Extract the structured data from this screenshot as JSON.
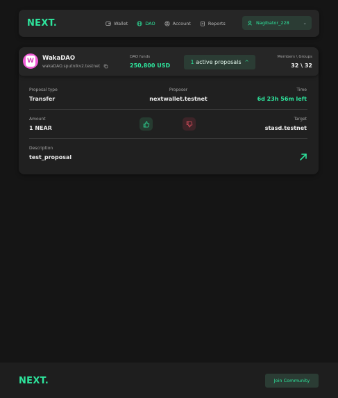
{
  "brand": {
    "logo": "NEXT."
  },
  "nav": {
    "items": [
      {
        "label": "Wallet",
        "icon": "wallet-icon",
        "active": false
      },
      {
        "label": "DAO",
        "icon": "globe-icon",
        "active": true
      },
      {
        "label": "Account",
        "icon": "account-icon",
        "active": false
      },
      {
        "label": "Reports",
        "icon": "reports-icon",
        "active": false
      }
    ],
    "user": {
      "label": "Nagibator_228",
      "icon": "user-icon"
    }
  },
  "dao": {
    "name": "WakaDAO",
    "address": "wakaDAO.sputnikv2.testnet",
    "funds_label": "DAO funds",
    "funds_value": "250,800 USD",
    "proposals_count": "1",
    "proposals_label": "active proposals",
    "members_label": "Members \\ Groups",
    "members_value": "32 \\ 32"
  },
  "proposal": {
    "type_label": "Proposal type",
    "type_value": "Transfer",
    "proposer_label": "Proposer",
    "proposer_value": "nextwallet.testnet",
    "time_label": "Time",
    "time_value": "6d 23h 56m left",
    "amount_label": "Amount",
    "amount_value": "1 NEAR",
    "target_label": "Target",
    "target_value": "stasd.testnet",
    "description_label": "Description",
    "description_value": "test_proposal"
  },
  "footer": {
    "logo": "NEXT.",
    "join_label": "Join Community"
  },
  "colors": {
    "accent": "#2ee59d",
    "background": "#151515",
    "card": "#262626",
    "avatar": "#f05bd6",
    "dislike": "#e0505f"
  }
}
